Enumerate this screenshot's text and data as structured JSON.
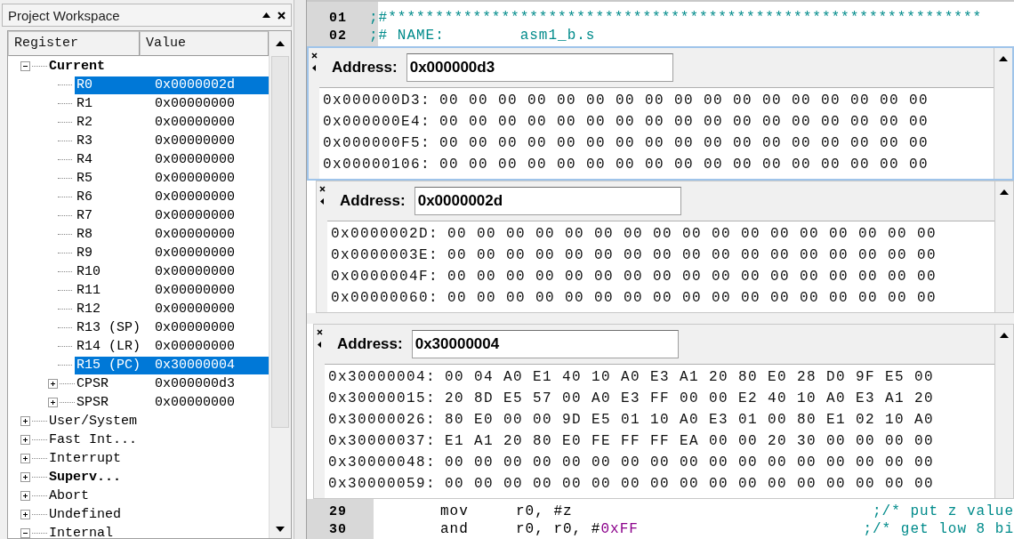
{
  "workspace": {
    "title": "Project Workspace",
    "columns": [
      "Register",
      "Value"
    ],
    "tree": [
      {
        "label": "Current",
        "bold": true,
        "expanded": true,
        "selected": false,
        "children": [
          {
            "label": "R0",
            "value": "0x0000002d",
            "selected": true
          },
          {
            "label": "R1",
            "value": "0x00000000",
            "selected": false
          },
          {
            "label": "R2",
            "value": "0x00000000",
            "selected": false
          },
          {
            "label": "R3",
            "value": "0x00000000",
            "selected": false
          },
          {
            "label": "R4",
            "value": "0x00000000",
            "selected": false
          },
          {
            "label": "R5",
            "value": "0x00000000",
            "selected": false
          },
          {
            "label": "R6",
            "value": "0x00000000",
            "selected": false
          },
          {
            "label": "R7",
            "value": "0x00000000",
            "selected": false
          },
          {
            "label": "R8",
            "value": "0x00000000",
            "selected": false
          },
          {
            "label": "R9",
            "value": "0x00000000",
            "selected": false
          },
          {
            "label": "R10",
            "value": "0x00000000",
            "selected": false
          },
          {
            "label": "R11",
            "value": "0x00000000",
            "selected": false
          },
          {
            "label": "R12",
            "value": "0x00000000",
            "selected": false
          },
          {
            "label": "R13 (SP)",
            "value": "0x00000000",
            "selected": false
          },
          {
            "label": "R14 (LR)",
            "value": "0x00000000",
            "selected": false
          },
          {
            "label": "R15 (PC)",
            "value": "0x30000004",
            "selected": true
          },
          {
            "label": "CPSR",
            "value": "0x000000d3",
            "expanded": false,
            "selected": false
          },
          {
            "label": "SPSR",
            "value": "0x00000000",
            "expanded": false,
            "selected": false
          }
        ]
      },
      {
        "label": "User/System",
        "bold": false,
        "expanded": false,
        "selected": false
      },
      {
        "label": "Fast Int...",
        "bold": false,
        "expanded": false,
        "selected": false
      },
      {
        "label": "Interrupt",
        "bold": false,
        "expanded": false,
        "selected": false
      },
      {
        "label": "Superv...",
        "bold": true,
        "expanded": false,
        "selected": false
      },
      {
        "label": "Abort",
        "bold": false,
        "expanded": false,
        "selected": false
      },
      {
        "label": "Undefined",
        "bold": false,
        "expanded": false,
        "selected": false
      },
      {
        "label": "Internal",
        "bold": false,
        "expanded": true,
        "selected": false
      }
    ]
  },
  "editor": {
    "top_lines": [
      {
        "number": "01",
        "text": ";#***************************************************************"
      },
      {
        "number": "02",
        "text": ";# NAME:        asm1_b.s"
      }
    ],
    "bottom_lines": [
      {
        "number": "29",
        "opcode": "mov",
        "operands": "r0, #z",
        "comment": ";/* put z value"
      },
      {
        "number": "30",
        "opcode": "and",
        "operands": "r0, r0, #",
        "literal": "0xFF",
        "comment": ";/* get low 8 bi"
      }
    ]
  },
  "memory_windows": [
    {
      "address_label": "Address:",
      "address": "0x000000d3",
      "active": true,
      "rows": [
        {
          "address": "0x000000D3:",
          "bytes": "00 00 00 00 00 00 00 00 00 00 00 00 00 00 00 00 00"
        },
        {
          "address": "0x000000E4:",
          "bytes": "00 00 00 00 00 00 00 00 00 00 00 00 00 00 00 00 00"
        },
        {
          "address": "0x000000F5:",
          "bytes": "00 00 00 00 00 00 00 00 00 00 00 00 00 00 00 00 00"
        },
        {
          "address": "0x00000106:",
          "bytes": "00 00 00 00 00 00 00 00 00 00 00 00 00 00 00 00 00"
        }
      ]
    },
    {
      "address_label": "Address:",
      "address": "0x0000002d",
      "active": false,
      "rows": [
        {
          "address": "0x0000002D:",
          "bytes": "00 00 00 00 00 00 00 00 00 00 00 00 00 00 00 00 00"
        },
        {
          "address": "0x0000003E:",
          "bytes": "00 00 00 00 00 00 00 00 00 00 00 00 00 00 00 00 00"
        },
        {
          "address": "0x0000004F:",
          "bytes": "00 00 00 00 00 00 00 00 00 00 00 00 00 00 00 00 00"
        },
        {
          "address": "0x00000060:",
          "bytes": "00 00 00 00 00 00 00 00 00 00 00 00 00 00 00 00 00"
        }
      ]
    },
    {
      "address_label": "Address:",
      "address": "0x30000004",
      "active": false,
      "rows": [
        {
          "address": "0x30000004:",
          "bytes": "00 04 A0 E1 40 10 A0 E3 A1 20 80 E0 28 D0 9F E5 00"
        },
        {
          "address": "0x30000015:",
          "bytes": "20 8D E5 57 00 A0 E3 FF 00 00 E2 40 10 A0 E3 A1 20"
        },
        {
          "address": "0x30000026:",
          "bytes": "80 E0 00 00 9D E5 01 10 A0 E3 01 00 80 E1 02 10 A0"
        },
        {
          "address": "0x30000037:",
          "bytes": "E1 A1 20 80 E0 FE FF FF EA 00 00 20 30 00 00 00 00"
        },
        {
          "address": "0x30000048:",
          "bytes": "00 00 00 00 00 00 00 00 00 00 00 00 00 00 00 00 00"
        },
        {
          "address": "0x30000059:",
          "bytes": "00 00 00 00 00 00 00 00 00 00 00 00 00 00 00 00 00"
        }
      ]
    }
  ]
}
